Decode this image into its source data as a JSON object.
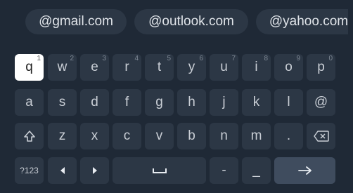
{
  "suggestions": [
    "@gmail.com",
    "@outlook.com",
    "@yahoo.com"
  ],
  "rows": [
    [
      {
        "label": "q",
        "hint": "1"
      },
      {
        "label": "w",
        "hint": "2"
      },
      {
        "label": "e",
        "hint": "3"
      },
      {
        "label": "r",
        "hint": "4"
      },
      {
        "label": "t",
        "hint": "5"
      },
      {
        "label": "y",
        "hint": "6"
      },
      {
        "label": "u",
        "hint": "7"
      },
      {
        "label": "i",
        "hint": "8"
      },
      {
        "label": "o",
        "hint": "9"
      },
      {
        "label": "p",
        "hint": "0"
      }
    ],
    [
      {
        "label": "a"
      },
      {
        "label": "s"
      },
      {
        "label": "d"
      },
      {
        "label": "f"
      },
      {
        "label": "g"
      },
      {
        "label": "h"
      },
      {
        "label": "j"
      },
      {
        "label": "k"
      },
      {
        "label": "l"
      },
      {
        "label": "@"
      }
    ],
    [
      {
        "label": "z"
      },
      {
        "label": "x"
      },
      {
        "label": "c"
      },
      {
        "label": "v"
      },
      {
        "label": "b"
      },
      {
        "label": "n"
      },
      {
        "label": "m"
      },
      {
        "label": "."
      }
    ]
  ],
  "bottom": {
    "symbols_label": "?123",
    "dash_label": "-",
    "underscore_label": "_"
  },
  "focused_key": "q",
  "colors": {
    "background": "#1f2936",
    "key": "#2c3745",
    "action_key": "#3f4c5e",
    "focused_key": "#ffffff"
  },
  "icons": {
    "shift": "shift-icon",
    "backspace": "backspace-icon",
    "left": "cursor-left-icon",
    "right": "cursor-right-icon",
    "space": "space-icon",
    "enter": "enter-arrow-icon"
  }
}
